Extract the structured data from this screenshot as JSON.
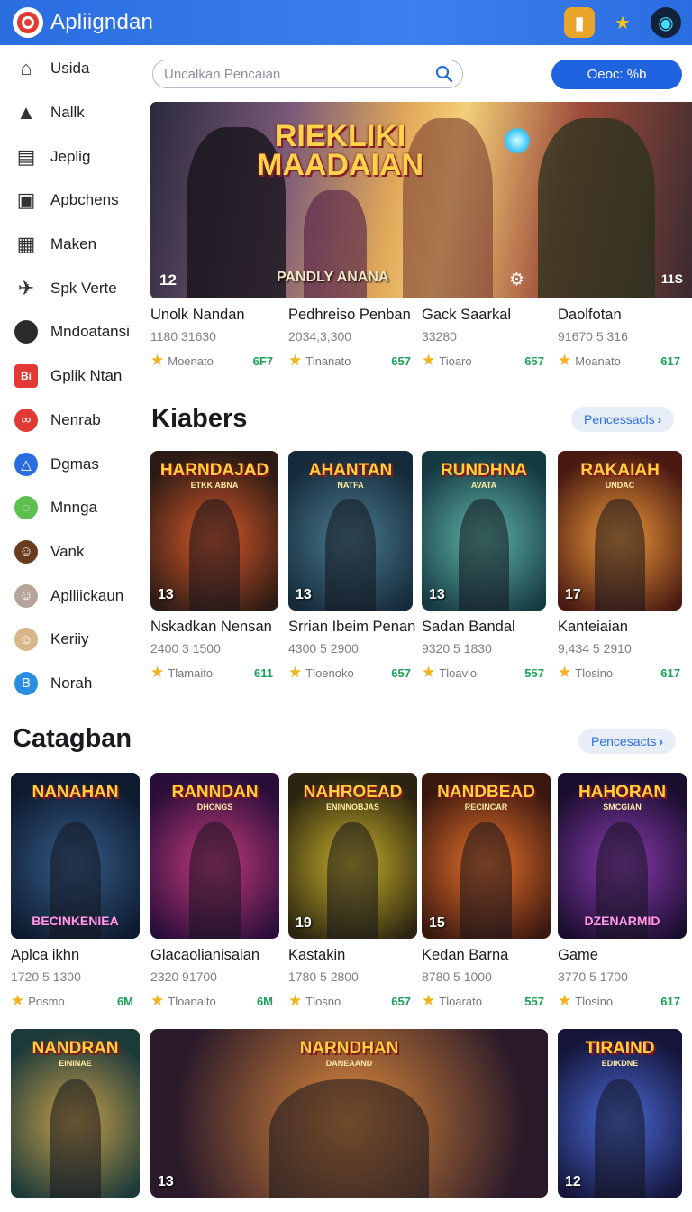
{
  "app": {
    "title": "Apliigndan"
  },
  "search": {
    "placeholder": "Uncalkan Pencaian"
  },
  "cta_label": "Oeoc: %b",
  "sidebar": {
    "items": [
      {
        "label": "Usida",
        "icon": "home-icon",
        "color": "#444"
      },
      {
        "label": "Nallk",
        "icon": "house-icon",
        "color": "#333"
      },
      {
        "label": "Jeplig",
        "icon": "store-icon",
        "color": "#333"
      },
      {
        "label": "Apbchens",
        "icon": "bag-icon",
        "color": "#333"
      },
      {
        "label": "Maken",
        "icon": "grid-icon",
        "color": "#333"
      },
      {
        "label": "Spk Verte",
        "icon": "plane-icon",
        "color": "#333"
      },
      {
        "label": "Mndoatansi",
        "icon": "circle-icon",
        "color": "#2b2b2b"
      },
      {
        "label": "Gplik Ntan",
        "icon": "bi-icon",
        "color": "#e13a35"
      },
      {
        "label": "Nenrab",
        "icon": "netflix-icon",
        "color": "#e13a35"
      },
      {
        "label": "Dgmas",
        "icon": "drive-icon",
        "color": "#2a6de0"
      },
      {
        "label": "Mnnga",
        "icon": "chat-icon",
        "color": "#5cc050"
      },
      {
        "label": "Vank",
        "icon": "avatar-icon",
        "color": "#6b3b20"
      },
      {
        "label": "Aplliickaun",
        "icon": "avatar2-icon",
        "color": "#b4a49a"
      },
      {
        "label": "Keriiy",
        "icon": "avatar3-icon",
        "color": "#d7b68c"
      },
      {
        "label": "Norah",
        "icon": "b-icon",
        "color": "#2a8de0"
      }
    ]
  },
  "hero": {
    "title_line1": "RIEKLIKI",
    "title_line2": "MAADAIAN",
    "subtitle": "PANDLY ANANA",
    "badge_left": "12",
    "badge_right": "11S"
  },
  "featured_row": [
    {
      "name": "Unolk Nandan",
      "meta": "1180 31630",
      "rating": "Moenato",
      "score": "6F7"
    },
    {
      "name": "Pedhreiso Penban",
      "meta": "2034,3,300",
      "rating": "Tinanato",
      "score": "657"
    },
    {
      "name": "Gack Saarkal",
      "meta": "33280",
      "rating": "Tioaro",
      "score": "657"
    },
    {
      "name": "Daolfotan",
      "meta": "91670 5 316",
      "rating": "Moanato",
      "score": "617"
    }
  ],
  "section1": {
    "title": "Kiabers",
    "more": "Pencessacls",
    "cards": [
      {
        "art": "HARNDAJAD",
        "art_sub": "ETKK ABNA",
        "num": "13",
        "name": "Nskadkan Nensan",
        "meta": "2400 3 1500",
        "rating": "Tlamaito",
        "score": "611",
        "c1": "#2b1b14",
        "c2": "#d9582a"
      },
      {
        "art": "AHANTAN",
        "art_sub": "NATFA",
        "num": "13",
        "name": "Srrian Ibeim Penan",
        "meta": "4300 5 2900",
        "rating": "Tloenoko",
        "score": "657",
        "c1": "#152a3a",
        "c2": "#4a7b90"
      },
      {
        "art": "RUNDHNA",
        "art_sub": "AVATA",
        "num": "13",
        "name": "Sadan Bandal",
        "meta": "9320 5 1830",
        "rating": "Tloavio",
        "score": "557",
        "c1": "#163a42",
        "c2": "#5fb5a8"
      },
      {
        "art": "RAKAIAH",
        "art_sub": "UNDAC",
        "num": "17",
        "name": "Kanteiaian",
        "meta": "9,434 5 2910",
        "rating": "Tlosino",
        "score": "617",
        "c1": "#4a1a12",
        "c2": "#f09a3a"
      }
    ]
  },
  "section2": {
    "title": "Catagban",
    "more": "Pencesacts",
    "cards": [
      {
        "art": "NANAHAN",
        "art_sub": "",
        "bot": "BECINKENIEA",
        "num": "",
        "name": "Aplca ikhn",
        "meta": "1720 5 1300",
        "rating": "Posmo",
        "score": "6M",
        "c1": "#0e1a2e",
        "c2": "#355d8a"
      },
      {
        "art": "RANNDAN",
        "art_sub": "DHONGS",
        "bot": "",
        "num": "",
        "name": "Glacaolianisaian",
        "meta": "2320 91700",
        "rating": "Tloanaito",
        "score": "6M",
        "c1": "#2a0e3a",
        "c2": "#c43a7a"
      },
      {
        "art": "NAHROEAD",
        "art_sub": "ENINNOBJAS",
        "bot": "",
        "num": "19",
        "name": "Kastakin",
        "meta": "1780 5 2800",
        "rating": "Tlosno",
        "score": "657",
        "c1": "#2a2410",
        "c2": "#c9b02a"
      },
      {
        "art": "NANDBEAD",
        "art_sub": "RECINCAR",
        "bot": "",
        "num": "15",
        "name": "Kedan Barna",
        "meta": "8780 5 1000",
        "rating": "Tloarato",
        "score": "557",
        "c1": "#3a1810",
        "c2": "#e8702a"
      },
      {
        "art": "HAHORAN",
        "art_sub": "SMCGIAN",
        "bot": "DZENARMID",
        "num": "",
        "name": "Game",
        "meta": "3770 5 1700",
        "rating": "Tlosino",
        "score": "617",
        "c1": "#1a0e2e",
        "c2": "#8a3ab0"
      }
    ]
  },
  "section3": {
    "cards": [
      {
        "art": "NANDRAN",
        "art_sub": "EININAE",
        "num": "",
        "c1": "#1c3a3a",
        "c2": "#c8a04a"
      },
      {
        "art": "NARNDHAN",
        "art_sub": "DANEAAND",
        "num": "13",
        "c1": "#2a1a2a",
        "c2": "#e08a3a"
      },
      {
        "art": "TIRAIND",
        "art_sub": "EDIKDNE",
        "num": "12",
        "c1": "#15153a",
        "c2": "#4a6ad8"
      }
    ]
  },
  "colors": {
    "accent": "#2a6de0",
    "topbar": "#3c7ff0",
    "star": "#f2b21b",
    "score": "#1aa05a"
  }
}
